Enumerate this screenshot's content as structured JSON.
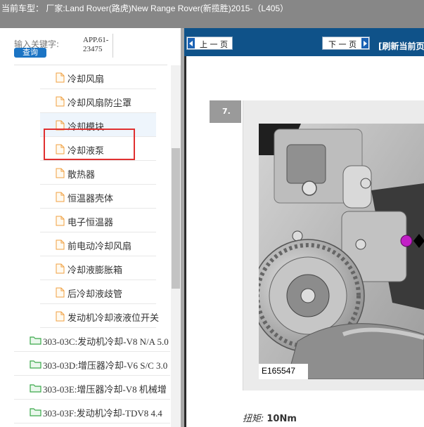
{
  "window": {
    "title": "当前车型： 厂家:Land Rover(路虎)New Range Rover(新揽胜)2015-（L405）"
  },
  "search": {
    "label": "输入关键字:",
    "value_line1": "APP.61-",
    "value_line2": "23475",
    "button_label": "查询"
  },
  "tree": {
    "files": [
      {
        "label": "冷却风扇"
      },
      {
        "label": "冷却风扇防尘罩"
      },
      {
        "label": "冷却模块",
        "selected": true
      },
      {
        "label": "冷却液泵",
        "marked": true
      },
      {
        "label": "散热器"
      },
      {
        "label": "恒温器壳体"
      },
      {
        "label": "电子恒温器"
      },
      {
        "label": "前电动冷却风扇"
      },
      {
        "label": "冷却液膨胀箱"
      },
      {
        "label": "后冷却液歧管"
      },
      {
        "label": "发动机冷却液液位开关"
      }
    ],
    "folders": [
      {
        "label": "303-03C:发动机冷却-V8 N/A 5.0"
      },
      {
        "label": "303-03D:增压器冷却-V6 S/C 3.0"
      },
      {
        "label": "303-03E:增压器冷却-V8 机械增"
      },
      {
        "label": "303-03F:发动机冷却-TDV8 4.4"
      }
    ]
  },
  "toolbar": {
    "prev_label": "上 一 页",
    "next_label": "下 一 页",
    "refresh_label": "[刷新当前页"
  },
  "content": {
    "step_number": "7.",
    "figure_id": "E165547",
    "torque_label": "扭矩:",
    "torque_value": "10Nm"
  },
  "icons": {
    "file": "document-icon",
    "folder": "folder-icon",
    "prev": "arrow-left-icon",
    "next": "arrow-right-icon"
  },
  "colors": {
    "header_bg": "#878787",
    "toolbar_bg": "#0f5289",
    "search_button": "#1b74c4",
    "highlight_box": "#e03030",
    "selected_row": "#eef5fc",
    "file_icon": "#f0a040",
    "folder_icon": "#3aa84a",
    "marker": "#c21fc6"
  }
}
